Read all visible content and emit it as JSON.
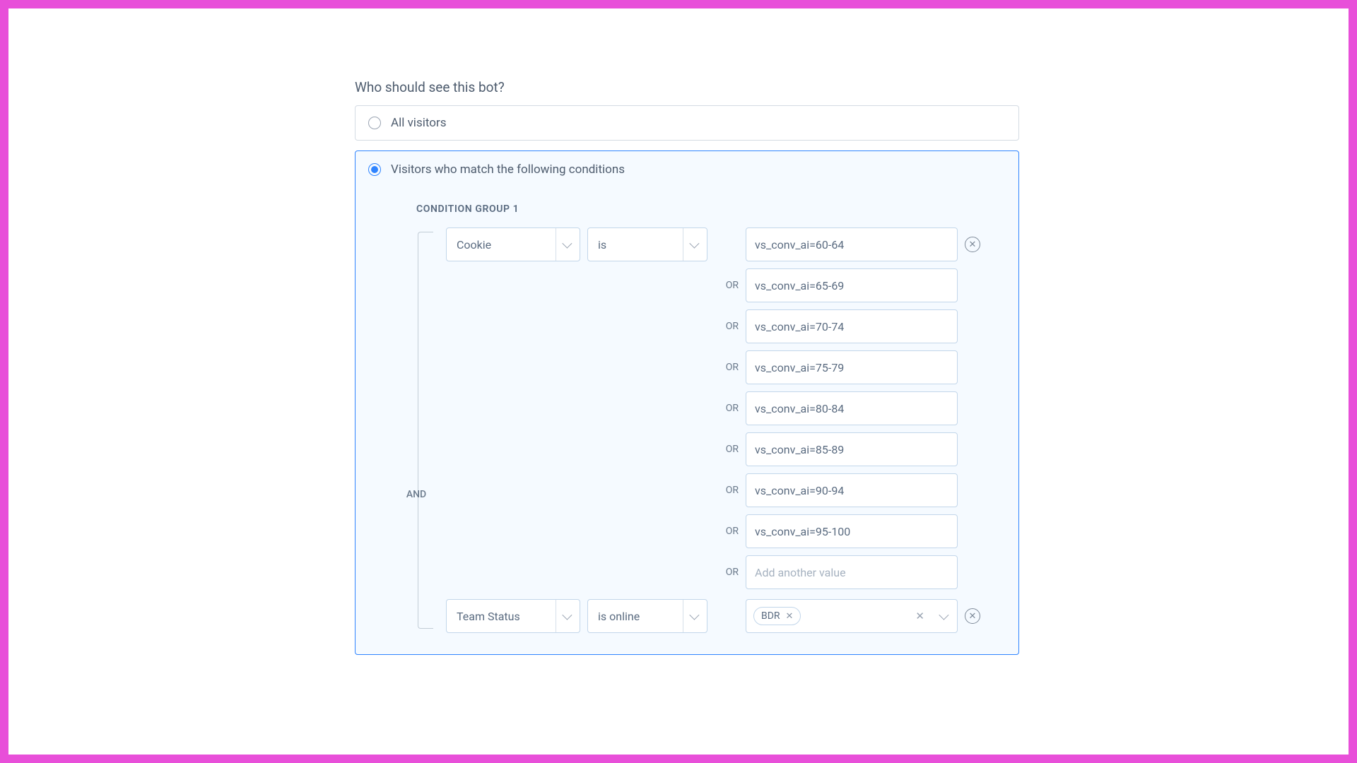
{
  "section_title": "Who should see this bot?",
  "option_all": "All visitors",
  "option_match": "Visitors who match the following conditions",
  "group_title": "CONDITION GROUP 1",
  "and_label": "AND",
  "or_label": "OR",
  "rule1": {
    "field": "Cookie",
    "operator": "is",
    "values": [
      "vs_conv_ai=60-64",
      "vs_conv_ai=65-69",
      "vs_conv_ai=70-74",
      "vs_conv_ai=75-79",
      "vs_conv_ai=80-84",
      "vs_conv_ai=85-89",
      "vs_conv_ai=90-94",
      "vs_conv_ai=95-100"
    ],
    "add_placeholder": "Add another value"
  },
  "rule2": {
    "field": "Team Status",
    "operator": "is online",
    "chip": "BDR"
  }
}
